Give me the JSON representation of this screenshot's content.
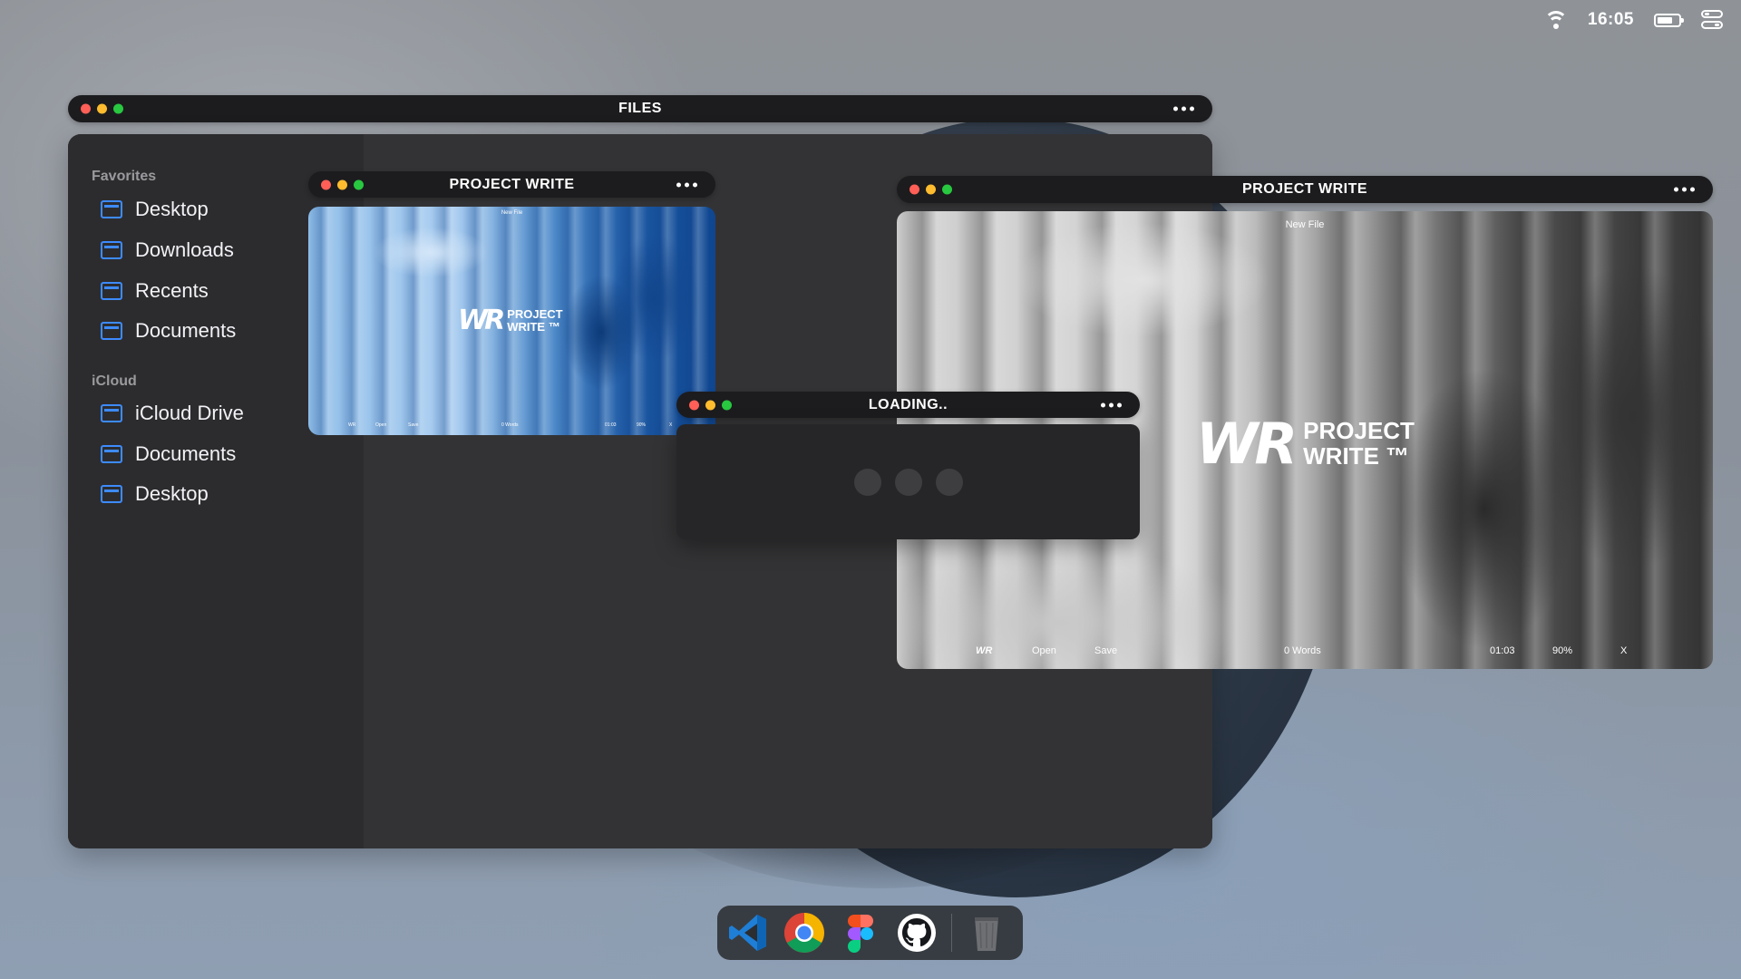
{
  "menubar": {
    "clock": "16:05",
    "icons": [
      "wifi-icon",
      "battery-icon",
      "control-center-icon"
    ]
  },
  "files_window": {
    "title": "FILES",
    "sidebar": {
      "favorites_header": "Favorites",
      "favorites": [
        {
          "label": "Desktop",
          "icon": "folder-icon"
        },
        {
          "label": "Downloads",
          "icon": "folder-icon"
        },
        {
          "label": "Recents",
          "icon": "folder-icon"
        },
        {
          "label": "Documents",
          "icon": "folder-icon"
        }
      ],
      "icloud_header": "iCloud",
      "icloud": [
        {
          "label": "iCloud Drive",
          "icon": "folder-icon"
        },
        {
          "label": "Documents",
          "icon": "folder-icon"
        },
        {
          "label": "Desktop",
          "icon": "folder-icon"
        }
      ]
    }
  },
  "project_write_small": {
    "title": "PROJECT WRITE",
    "new_file": "New File",
    "logo_mark": "WR",
    "logo_line1": "PROJECT",
    "logo_line2": "WRITE ™",
    "footer": {
      "logo": "WR",
      "open": "Open",
      "save": "Save",
      "words": "0 Words",
      "time": "01:03",
      "zoom": "90%",
      "close": "X"
    }
  },
  "project_write_large": {
    "title": "PROJECT WRITE",
    "new_file": "New File",
    "logo_mark": "WR",
    "logo_line1": "PROJECT",
    "logo_line2": "WRITE ™",
    "footer": {
      "logo": "WR",
      "open": "Open",
      "save": "Save",
      "words": "0 Words",
      "time": "01:03",
      "zoom": "90%",
      "close": "X"
    }
  },
  "loading_window": {
    "title": "LOADING.."
  },
  "dock": {
    "apps": [
      "vscode-icon",
      "chrome-icon",
      "figma-icon",
      "github-icon",
      "trash-icon"
    ]
  },
  "colors": {
    "accent_blue": "#3d8bff",
    "traffic_red": "#ff5f57",
    "traffic_yellow": "#febc2e",
    "traffic_green": "#28c840"
  }
}
